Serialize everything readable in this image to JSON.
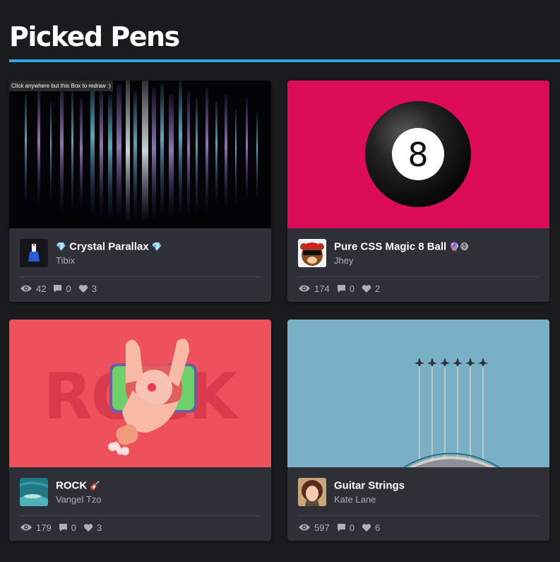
{
  "page": {
    "title": "Picked Pens",
    "accent": "#2fa5e6"
  },
  "cards": [
    {
      "title": "Crystal Parallax",
      "title_prefix": "💎",
      "title_suffix": "💎",
      "author": "Tibix",
      "views": "42",
      "comments": "0",
      "likes": "3",
      "thumb_note": "Click anywhere but this Box to redraw :)"
    },
    {
      "title": "Pure CSS Magic 8 Ball",
      "title_suffix": "🔮😅",
      "author": "Jhey",
      "views": "174",
      "comments": "0",
      "likes": "2",
      "thumb_text": "8"
    },
    {
      "title": "ROCK",
      "title_suffix": "🎸",
      "author": "Vangel Tzo",
      "views": "179",
      "comments": "0",
      "likes": "3",
      "thumb_text": "ROCK"
    },
    {
      "title": "Guitar Strings",
      "author": "Kate Lane",
      "views": "597",
      "comments": "0",
      "likes": "6"
    }
  ],
  "icons": {
    "views": "eye-icon",
    "comments": "comment-icon",
    "likes": "heart-icon"
  }
}
